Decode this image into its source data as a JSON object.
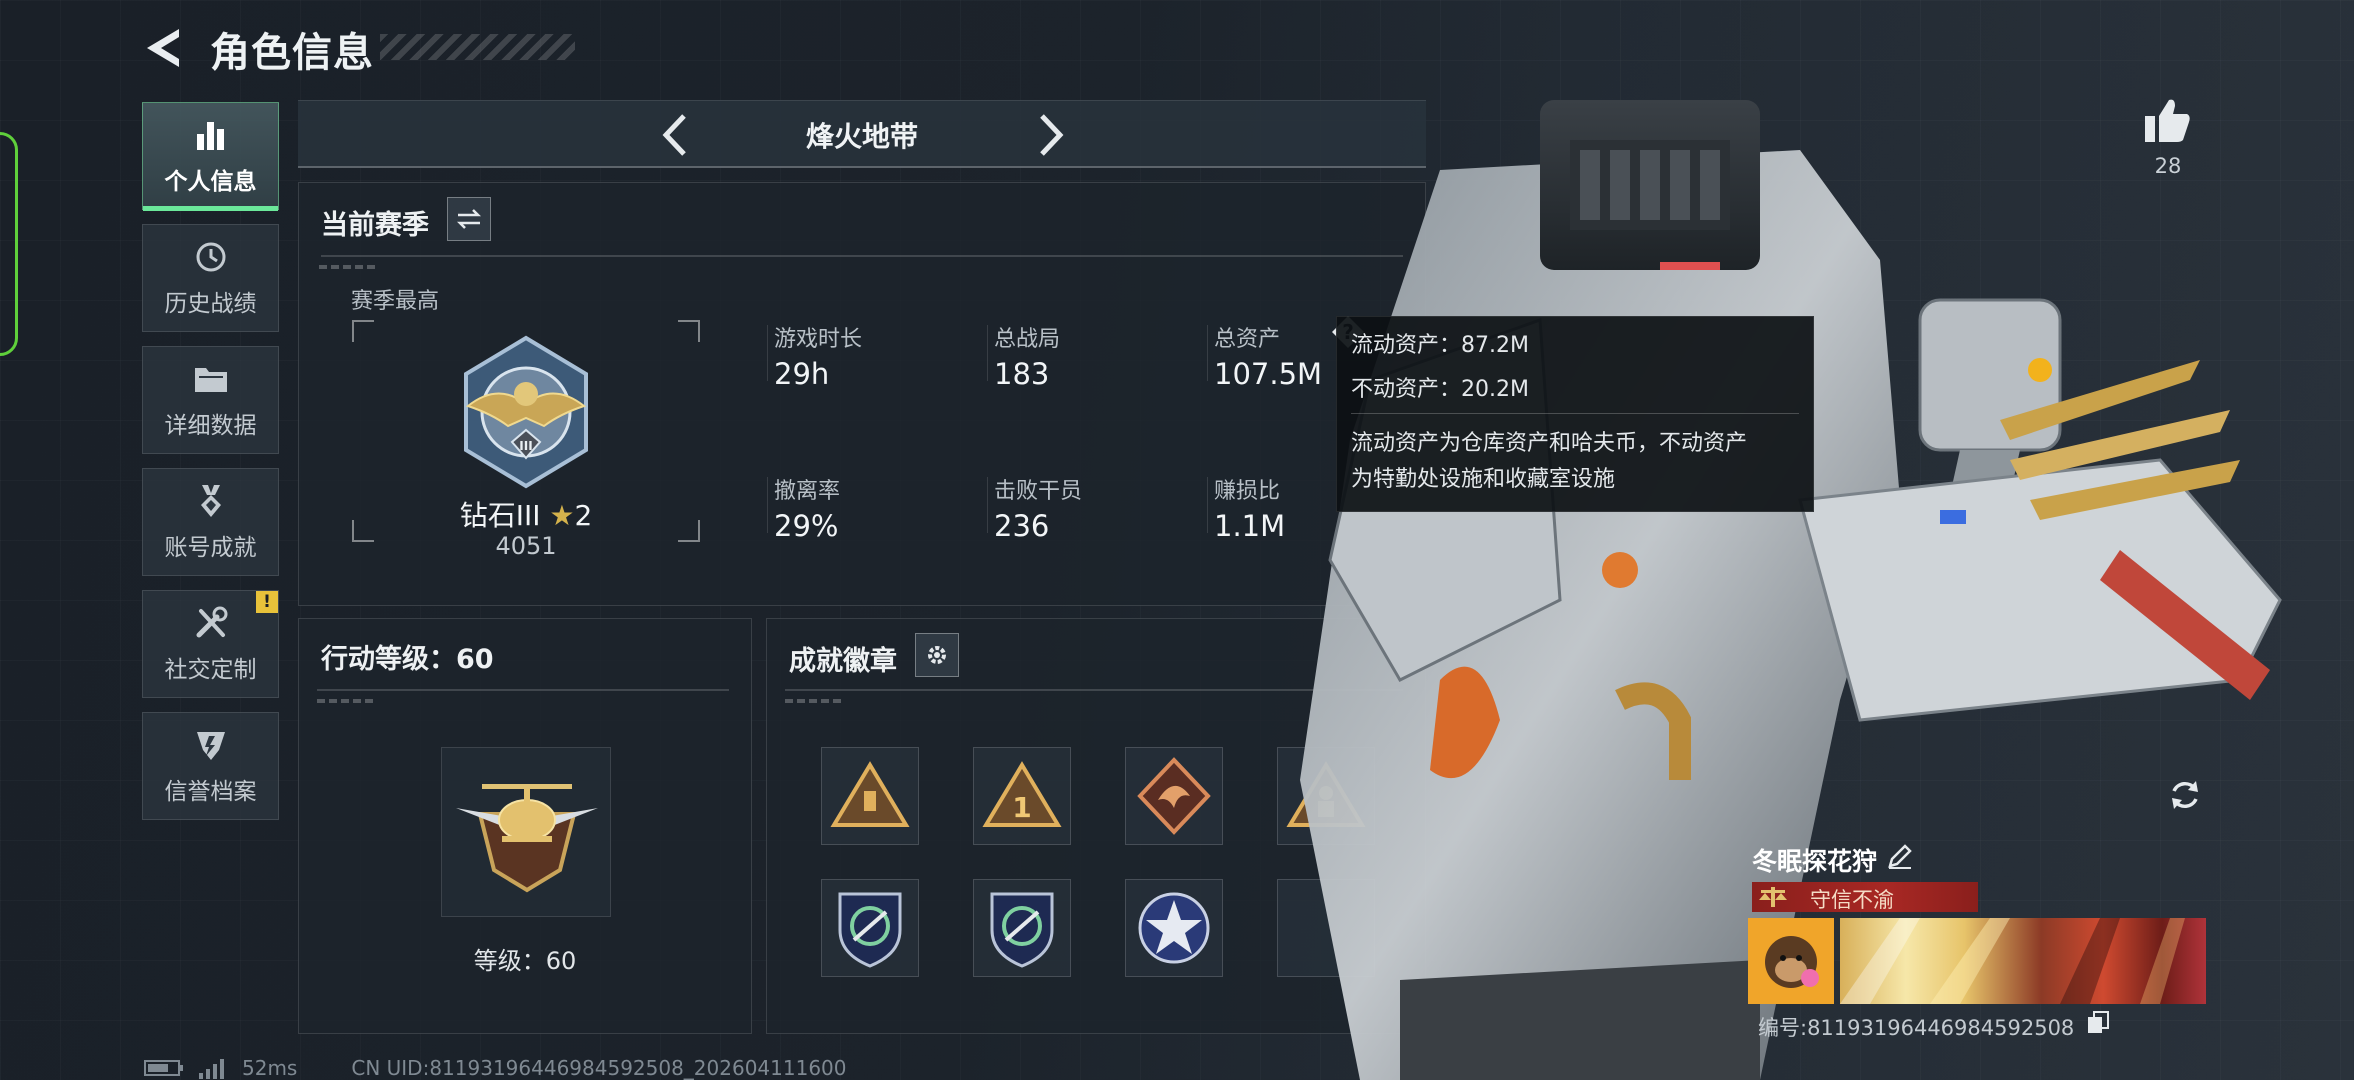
{
  "header": {
    "title": "角色信息"
  },
  "sidebar": {
    "items": [
      {
        "label": "个人信息",
        "icon": "bar-chart-icon",
        "active": true
      },
      {
        "label": "历史战绩",
        "icon": "history-clock-icon"
      },
      {
        "label": "详细数据",
        "icon": "folder-icon"
      },
      {
        "label": "账号成就",
        "icon": "achievement-medal-icon"
      },
      {
        "label": "社交定制",
        "icon": "wrench-screwdriver-icon",
        "badge": "!"
      },
      {
        "label": "信誉档案",
        "icon": "credit-shield-icon"
      }
    ]
  },
  "mode_selector": {
    "title": "烽火地带"
  },
  "season": {
    "heading": "当前赛季",
    "best_label": "赛季最高",
    "rank_name": "钻石III",
    "rank_stars": "2",
    "rank_points": "4051",
    "stats": [
      {
        "label": "游戏时长",
        "value": "29h"
      },
      {
        "label": "总战局",
        "value": "183"
      },
      {
        "label": "总资产",
        "value": "107.5M"
      },
      {
        "label": "撤离率",
        "value": "29%"
      },
      {
        "label": "击败干员",
        "value": "236"
      },
      {
        "label": "赚损比",
        "value": "1.1M"
      }
    ]
  },
  "tooltip": {
    "line1": "流动资产：87.2M",
    "line2": "不动资产：20.2M",
    "desc1": "流动资产为仓库资产和哈夫币，不动资产",
    "desc2": "为特勤处设施和收藏室设施"
  },
  "action_level": {
    "heading": "行动等级：60",
    "level_text": "等级：60"
  },
  "achievements": {
    "heading": "成就徽章"
  },
  "likes": {
    "count": "28"
  },
  "profile": {
    "name": "冬眠探花狩",
    "title_tag": "守信不渝",
    "id_text": "编号:81193196446984592508"
  },
  "footer": {
    "ping": "52ms",
    "uid": "CN UID:81193196446984592508_202604111600"
  },
  "colors": {
    "accent_green": "#6be89a",
    "edge_green": "#5fd03b",
    "warn_yellow": "#e8c23a",
    "title_red": "#a82824"
  }
}
